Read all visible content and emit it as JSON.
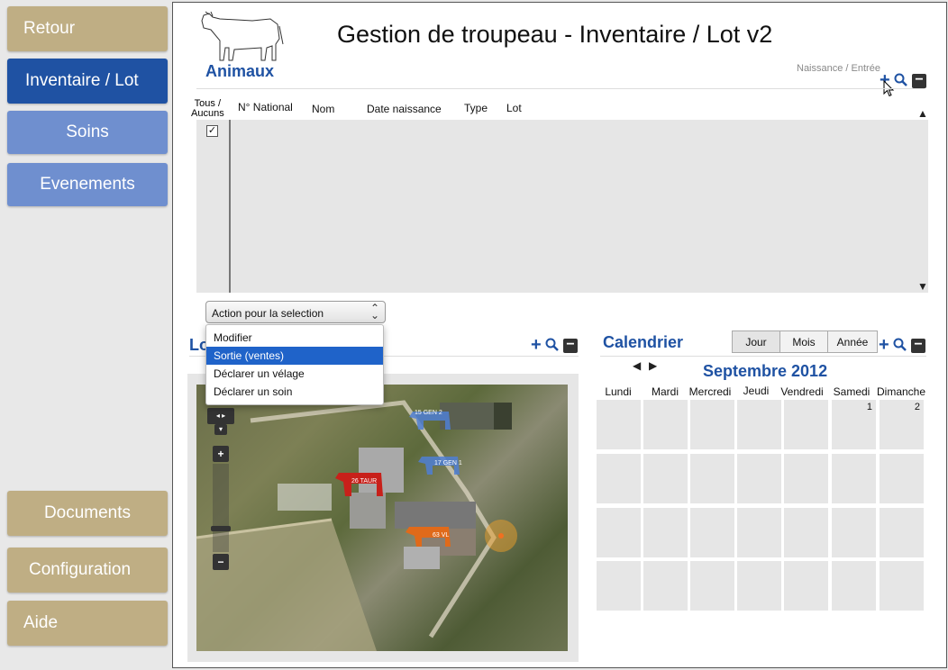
{
  "sidebar": {
    "items": [
      {
        "label": "Retour"
      },
      {
        "label": "Inventaire / Lot"
      },
      {
        "label": "Soins"
      },
      {
        "label": "Evenements"
      },
      {
        "label": "Documents"
      },
      {
        "label": "Configuration"
      },
      {
        "label": "Aide"
      }
    ]
  },
  "header": {
    "title": "Gestion de troupeau - Inventaire / Lot v2",
    "section": "Animaux",
    "action_hint": "Naissance / Entrée"
  },
  "table": {
    "select_all": "Tous /\nAucuns",
    "columns": [
      "N° National",
      "Nom",
      "Date naissance",
      "Type",
      "Lot"
    ],
    "select_all_checked": true
  },
  "action_select": {
    "value": "Action pour la selection",
    "options": [
      "Modifier",
      "Sortie (ventes)",
      "Déclarer un vélage",
      "Déclarer un soin"
    ],
    "highlighted": "Sortie (ventes)"
  },
  "lots": {
    "title": "Lo",
    "map_labels": [
      "15 GEN 2",
      "17 GEN 1",
      "26 TAUR",
      "63 VL"
    ]
  },
  "calendar": {
    "title": "Calendrier",
    "tabs": [
      "Jour",
      "Mois",
      "Année"
    ],
    "active_tab": "Jour",
    "month": "Septembre 2012",
    "days": [
      "Lundi",
      "Mardi",
      "Mercredi",
      "Jeudi",
      "Vendredi",
      "Samedi",
      "Dimanche"
    ],
    "first_row_numbers": [
      "",
      "",
      "",
      "",
      "",
      "1",
      "2"
    ]
  },
  "colors": {
    "nav_tan": "#bfae84",
    "nav_active": "#1f52a3",
    "nav_secondary": "#6f8fcf",
    "accent": "#1f52a3",
    "dropdown_highlight": "#1f63c9"
  }
}
